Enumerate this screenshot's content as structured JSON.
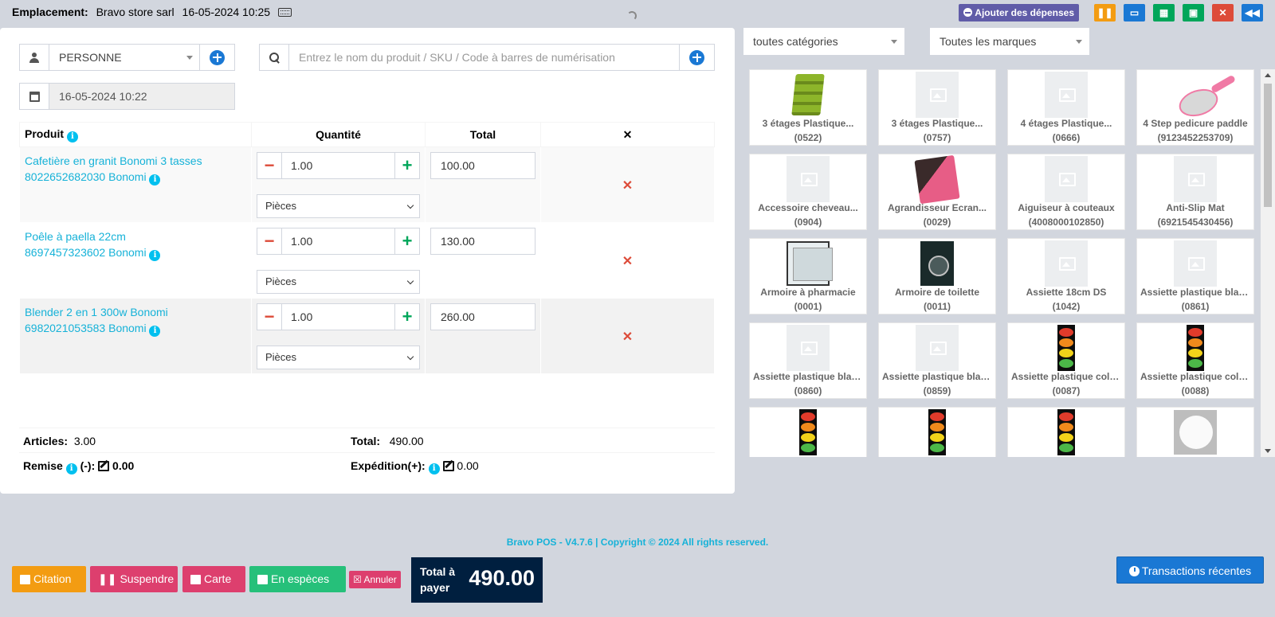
{
  "topbar": {
    "location_label": "Emplacement:",
    "store": "Bravo store sarl",
    "datetime": "16-05-2024 10:25",
    "expense_button": "Ajouter des dépenses"
  },
  "customer": {
    "value": "PERSONNE"
  },
  "search": {
    "placeholder": "Entrez le nom du produit / SKU / Code à barres de numérisation"
  },
  "date_field": {
    "value": "16-05-2024 10:22"
  },
  "table": {
    "headers": {
      "product": "Produit",
      "quantity": "Quantité",
      "total": "Total",
      "remove": "✕"
    },
    "rows": [
      {
        "name": "Cafetière en granit Bonomi 3 tasses",
        "sku_brand": "8022652682030 Bonomi",
        "qty": "1.00",
        "unit": "Pièces",
        "total": "100.00"
      },
      {
        "name": "Poêle à paella 22cm",
        "sku_brand": "8697457323602 Bonomi",
        "qty": "1.00",
        "unit": "Pièces",
        "total": "130.00"
      },
      {
        "name": "Blender 2 en 1 300w Bonomi",
        "sku_brand": "6982021053583 Bonomi",
        "qty": "1.00",
        "unit": "Pièces",
        "total": "260.00"
      }
    ]
  },
  "summary": {
    "articles_label": "Articles:",
    "articles_value": "3.00",
    "total_label": "Total:",
    "total_value": "490.00",
    "discount_label": "Remise",
    "discount_suffix": "(-):",
    "discount_value": "0.00",
    "shipping_label": "Expédition(+):",
    "shipping_value": "0.00"
  },
  "filters": {
    "category": "toutes catégories",
    "brand": "Toutes les marques"
  },
  "products": [
    {
      "name": "3 étages Plastique...",
      "sku": "(0522)",
      "img": "shelf"
    },
    {
      "name": "3 étages Plastique...",
      "sku": "(0757)",
      "img": "placeholder"
    },
    {
      "name": "4 étages Plastique...",
      "sku": "(0666)",
      "img": "placeholder"
    },
    {
      "name": "4 Step pedicure paddle",
      "sku": "(9123452253709)",
      "img": "paddle"
    },
    {
      "name": "Accessoire cheveau...",
      "sku": "(0904)",
      "img": "placeholder"
    },
    {
      "name": "Agrandisseur Ecran...",
      "sku": "(0029)",
      "img": "magnifier"
    },
    {
      "name": "Aiguiseur à couteaux",
      "sku": "(4008000102850)",
      "img": "placeholder"
    },
    {
      "name": "Anti-Slip Mat",
      "sku": "(6921545430456)",
      "img": "placeholder"
    },
    {
      "name": "Armoire à pharmacie",
      "sku": "(0001)",
      "img": "cabinet"
    },
    {
      "name": "Armoire de toilette",
      "sku": "(0011)",
      "img": "dark"
    },
    {
      "name": "Assiette 18cm DS",
      "sku": "(1042)",
      "img": "placeholder"
    },
    {
      "name": "Assiette plastique blan...",
      "sku": "(0861)",
      "img": "placeholder"
    },
    {
      "name": "Assiette plastique blan...",
      "sku": "(0860)",
      "img": "placeholder"
    },
    {
      "name": "Assiette plastique blan...",
      "sku": "(0859)",
      "img": "placeholder"
    },
    {
      "name": "Assiette plastique colo...",
      "sku": "(0087)",
      "img": "plates"
    },
    {
      "name": "Assiette plastique colo...",
      "sku": "(0088)",
      "img": "plates"
    },
    {
      "name": "",
      "sku": "",
      "img": "plates"
    },
    {
      "name": "",
      "sku": "",
      "img": "plates"
    },
    {
      "name": "",
      "sku": "",
      "img": "plates"
    },
    {
      "name": "",
      "sku": "",
      "img": "plate"
    }
  ],
  "footer": {
    "copyright": "Bravo POS - V4.7.6 | Copyright © 2024 All rights reserved."
  },
  "actions": {
    "quote": "Citation",
    "suspend": "Suspendre",
    "card": "Carte",
    "cash": "En espèces",
    "cancel": "Annuler",
    "total_to_pay_label": "Total à payer",
    "total_to_pay_value": "490.00",
    "recent_transactions": "Transactions récentes"
  },
  "colors": {
    "accent_blue": "#1a78d4",
    "link_cyan": "#16b2d8",
    "danger": "#dd4b39",
    "success": "#00a65a",
    "navy": "#001f3f"
  }
}
